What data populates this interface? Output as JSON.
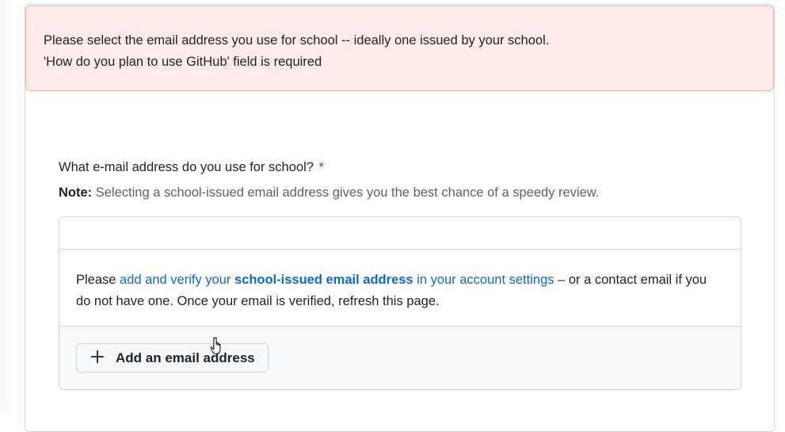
{
  "flash": {
    "line1": "Please select the email address you use for school -- ideally one issued by your school.",
    "line2": "'How do you plan to use GitHub' field is required"
  },
  "question": {
    "label": "What e-mail address do you use for school?",
    "required_marker": "*"
  },
  "note": {
    "label": "Note:",
    "text": "Selecting a school-issued email address gives you the best chance of a speedy review."
  },
  "email_box": {
    "body_prefix": "Please ",
    "link_part1": "add and verify your ",
    "link_bold": "school-issued email address",
    "link_part2": " in your account settings",
    "body_suffix": " – or a contact email if you do not have one. Once your email is verified, refresh this page.",
    "add_button_label": "Add an email address"
  },
  "icons": {
    "add": "plus-icon",
    "cursor": "hand-pointer-icon"
  },
  "colors": {
    "error_bg": "#ffebe9",
    "error_border": "#f3b3ad",
    "link": "#0969da",
    "required": "#cf222e"
  }
}
